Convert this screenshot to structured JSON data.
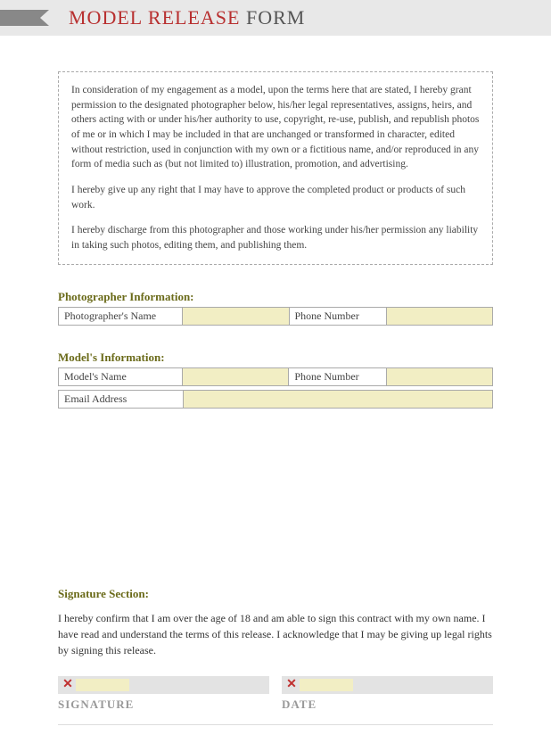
{
  "header": {
    "title_red": "MODEL RELEASE",
    "title_rest": " FORM"
  },
  "legal": {
    "p1": "In consideration of my engagement as a model, upon the terms here that are stated, I hereby grant permission to the designated photographer below, his/her legal representatives, assigns, heirs, and others acting with or under his/her authority to use, copyright, re-use, publish, and republish photos of me or in which I may be included in that are unchanged or transformed in character, edited without restriction, used in conjunction with my own or a fictitious name, and/or reproduced in any form of media such as (but not limited to) illustration, promotion, and advertising.",
    "p2": "I hereby give up any right that I may have to approve the completed product or products of such work.",
    "p3": "I hereby discharge from this photographer and those working under his/her permission any liability in taking such photos, editing them, and publishing them."
  },
  "photographer": {
    "heading": "Photographer Information:",
    "name_label": "Photographer's Name",
    "phone_label": "Phone Number"
  },
  "model": {
    "heading": "Model's Information:",
    "name_label": "Model's Name",
    "phone_label": "Phone Number",
    "email_label": "Email Address"
  },
  "signature": {
    "heading": "Signature Section:",
    "text": "I hereby confirm that I am over the age of 18 and am able to sign this contract with my own name. I have read and understand the terms of this release.  I acknowledge that I may be giving up legal rights by signing this release.",
    "sig_label": "SIGNATURE",
    "date_label": "DATE"
  }
}
